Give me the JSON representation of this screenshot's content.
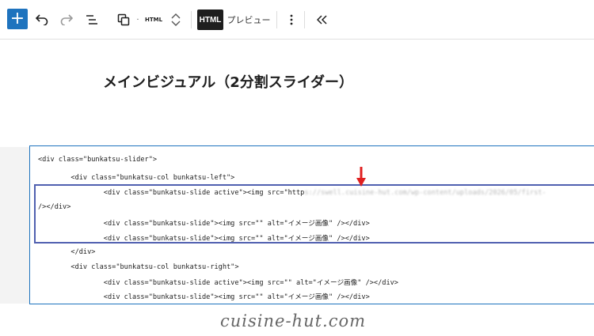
{
  "toolbar": {
    "add_icon": "plus-icon",
    "undo_icon": "undo-icon",
    "redo_icon": "redo-icon",
    "list_icon": "list-view-icon",
    "copy_icon": "duplicate-icon",
    "dot": "·",
    "format_label": "HTML",
    "html_button": "HTML",
    "preview_label": "プレビュー",
    "more_icon": "more-vertical-icon",
    "collapse_icon": "chevron-double-left-icon",
    "accent_color": "#1e73be"
  },
  "heading": "メインビジュアル（2分割スライダー）",
  "code_lines": [
    {
      "indent": "",
      "text": "<div class=\"bunkatsu-slider\">",
      "blur": ""
    },
    {
      "indent": "        ",
      "text": "<div class=\"bunkatsu-col bunkatsu-left\">",
      "blur": ""
    },
    {
      "indent": "                ",
      "text": "<div class=\"bunkatsu-slide active\"><img src=\"http",
      "blur": "s://swell.cuisine-hut.com/wp-content/uploads/2026/05/first-"
    },
    {
      "indent": "",
      "text": "/></div>",
      "blur": ""
    },
    {
      "indent": "                ",
      "text": "<div class=\"bunkatsu-slide\"><img src=\"\" alt=\"イメージ画像\" /></div>",
      "blur": ""
    },
    {
      "indent": "                ",
      "text": "<div class=\"bunkatsu-slide\"><img src=\"\" alt=\"イメージ画像\" /></div>",
      "blur": ""
    },
    {
      "indent": "        ",
      "text": "</div>",
      "blur": ""
    },
    {
      "indent": "        ",
      "text": "<div class=\"bunkatsu-col bunkatsu-right\">",
      "blur": ""
    },
    {
      "indent": "                ",
      "text": "<div class=\"bunkatsu-slide active\"><img src=\"\" alt=\"イメージ画像\" /></div>",
      "blur": ""
    },
    {
      "indent": "                ",
      "text": "<div class=\"bunkatsu-slide\"><img src=\"\" alt=\"イメージ画像\" /></div>",
      "blur": ""
    }
  ],
  "annotation": {
    "highlight_color": "#5060b0",
    "arrow_color": "#e02020"
  },
  "watermark": "cuisine-hut.com"
}
